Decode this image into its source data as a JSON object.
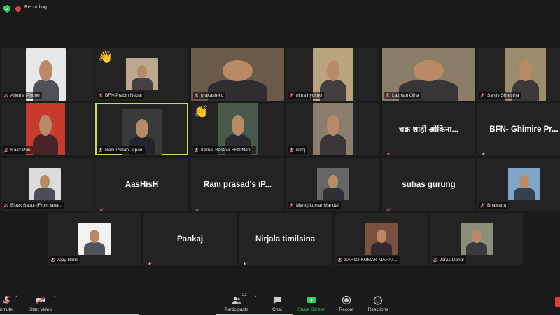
{
  "topbar": {
    "recording_label": "Recording"
  },
  "participants": [
    {
      "name": "Arjun's iPhone",
      "type": "video",
      "bg": "#e8e8e8"
    },
    {
      "name": "BFN-Prabin Nepal",
      "type": "video",
      "bg": "#bca88f",
      "reaction": "👋"
    },
    {
      "name": "prakash-kc",
      "type": "video",
      "bg": "#6b5a4a"
    },
    {
      "name": "nima hyolmo",
      "type": "video",
      "bg": "#b9a480"
    },
    {
      "name": "Laxman Ojha",
      "type": "video",
      "bg": "#8a7d66"
    },
    {
      "name": "Sanjiv Shrestha",
      "type": "video",
      "bg": "#9b8c6e"
    },
    {
      "name": "Raaz Puri",
      "type": "video",
      "bg": "#c73b2c"
    },
    {
      "name": "Rahul Shah Japan",
      "type": "video",
      "bg": "#3a3a3a",
      "active": true
    },
    {
      "name": "Kamal Bastola BFN/Nep...",
      "type": "video",
      "bg": "#4a5a4a",
      "reaction": "👏"
    },
    {
      "name": "Niroj",
      "type": "video",
      "bg": "#8b7d6b"
    },
    {
      "name": "चक्र शाही ओकिना...",
      "type": "text"
    },
    {
      "name": "BFN- Ghimire Pr...",
      "type": "text"
    },
    {
      "name": "Bibek Babu- (From jana...",
      "type": "video",
      "bg": "#dcdcdc"
    },
    {
      "name": "AasHisH",
      "type": "text"
    },
    {
      "name": "Ram prasad's iP...",
      "type": "text"
    },
    {
      "name": "Manoj kumar Mandal",
      "type": "video",
      "bg": "#666"
    },
    {
      "name": "subas gurung",
      "type": "text"
    },
    {
      "name": "Bhawana",
      "type": "video",
      "bg": "#7fa6c9"
    },
    {
      "name": "Ajay Rana",
      "type": "video",
      "bg": "#f2f2f2"
    },
    {
      "name": "Pankaj",
      "type": "text"
    },
    {
      "name": "Nirjala timilsina",
      "type": "text"
    },
    {
      "name": "SAROJ KUMAR MAHAT...",
      "type": "video",
      "bg": "#7a5040"
    },
    {
      "name": "Joras Dahal",
      "type": "video",
      "bg": "#8a8f7a"
    }
  ],
  "toolbar": {
    "unmute": "nmute",
    "start_video": "Start Video",
    "participants": "Participants",
    "participants_count": "23",
    "chat": "Chat",
    "share_screen": "Share Screen",
    "record": "Record",
    "reactions": "Reactions"
  },
  "colors": {
    "active_speaker": "#c6e05a",
    "share_green": "#2fd15c",
    "end_red": "#e0403a"
  }
}
